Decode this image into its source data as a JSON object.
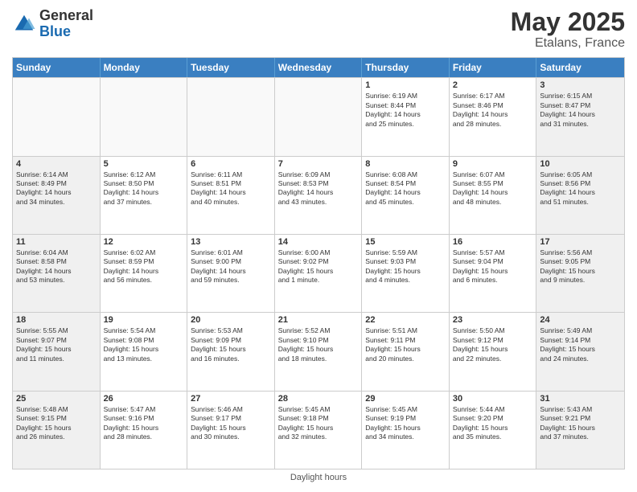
{
  "header": {
    "logo_general": "General",
    "logo_blue": "Blue",
    "title": "May 2025",
    "subtitle": "Etalans, France"
  },
  "calendar": {
    "days_of_week": [
      "Sunday",
      "Monday",
      "Tuesday",
      "Wednesday",
      "Thursday",
      "Friday",
      "Saturday"
    ],
    "footer": "Daylight hours",
    "rows": [
      [
        {
          "day": "",
          "text": "",
          "empty": true
        },
        {
          "day": "",
          "text": "",
          "empty": true
        },
        {
          "day": "",
          "text": "",
          "empty": true
        },
        {
          "day": "",
          "text": "",
          "empty": true
        },
        {
          "day": "1",
          "text": "Sunrise: 6:19 AM\nSunset: 8:44 PM\nDaylight: 14 hours\nand 25 minutes.",
          "empty": false
        },
        {
          "day": "2",
          "text": "Sunrise: 6:17 AM\nSunset: 8:46 PM\nDaylight: 14 hours\nand 28 minutes.",
          "empty": false
        },
        {
          "day": "3",
          "text": "Sunrise: 6:15 AM\nSunset: 8:47 PM\nDaylight: 14 hours\nand 31 minutes.",
          "empty": false,
          "shaded": true
        }
      ],
      [
        {
          "day": "4",
          "text": "Sunrise: 6:14 AM\nSunset: 8:49 PM\nDaylight: 14 hours\nand 34 minutes.",
          "empty": false,
          "shaded": true
        },
        {
          "day": "5",
          "text": "Sunrise: 6:12 AM\nSunset: 8:50 PM\nDaylight: 14 hours\nand 37 minutes.",
          "empty": false
        },
        {
          "day": "6",
          "text": "Sunrise: 6:11 AM\nSunset: 8:51 PM\nDaylight: 14 hours\nand 40 minutes.",
          "empty": false
        },
        {
          "day": "7",
          "text": "Sunrise: 6:09 AM\nSunset: 8:53 PM\nDaylight: 14 hours\nand 43 minutes.",
          "empty": false
        },
        {
          "day": "8",
          "text": "Sunrise: 6:08 AM\nSunset: 8:54 PM\nDaylight: 14 hours\nand 45 minutes.",
          "empty": false
        },
        {
          "day": "9",
          "text": "Sunrise: 6:07 AM\nSunset: 8:55 PM\nDaylight: 14 hours\nand 48 minutes.",
          "empty": false
        },
        {
          "day": "10",
          "text": "Sunrise: 6:05 AM\nSunset: 8:56 PM\nDaylight: 14 hours\nand 51 minutes.",
          "empty": false,
          "shaded": true
        }
      ],
      [
        {
          "day": "11",
          "text": "Sunrise: 6:04 AM\nSunset: 8:58 PM\nDaylight: 14 hours\nand 53 minutes.",
          "empty": false,
          "shaded": true
        },
        {
          "day": "12",
          "text": "Sunrise: 6:02 AM\nSunset: 8:59 PM\nDaylight: 14 hours\nand 56 minutes.",
          "empty": false
        },
        {
          "day": "13",
          "text": "Sunrise: 6:01 AM\nSunset: 9:00 PM\nDaylight: 14 hours\nand 59 minutes.",
          "empty": false
        },
        {
          "day": "14",
          "text": "Sunrise: 6:00 AM\nSunset: 9:02 PM\nDaylight: 15 hours\nand 1 minute.",
          "empty": false
        },
        {
          "day": "15",
          "text": "Sunrise: 5:59 AM\nSunset: 9:03 PM\nDaylight: 15 hours\nand 4 minutes.",
          "empty": false
        },
        {
          "day": "16",
          "text": "Sunrise: 5:57 AM\nSunset: 9:04 PM\nDaylight: 15 hours\nand 6 minutes.",
          "empty": false
        },
        {
          "day": "17",
          "text": "Sunrise: 5:56 AM\nSunset: 9:05 PM\nDaylight: 15 hours\nand 9 minutes.",
          "empty": false,
          "shaded": true
        }
      ],
      [
        {
          "day": "18",
          "text": "Sunrise: 5:55 AM\nSunset: 9:07 PM\nDaylight: 15 hours\nand 11 minutes.",
          "empty": false,
          "shaded": true
        },
        {
          "day": "19",
          "text": "Sunrise: 5:54 AM\nSunset: 9:08 PM\nDaylight: 15 hours\nand 13 minutes.",
          "empty": false
        },
        {
          "day": "20",
          "text": "Sunrise: 5:53 AM\nSunset: 9:09 PM\nDaylight: 15 hours\nand 16 minutes.",
          "empty": false
        },
        {
          "day": "21",
          "text": "Sunrise: 5:52 AM\nSunset: 9:10 PM\nDaylight: 15 hours\nand 18 minutes.",
          "empty": false
        },
        {
          "day": "22",
          "text": "Sunrise: 5:51 AM\nSunset: 9:11 PM\nDaylight: 15 hours\nand 20 minutes.",
          "empty": false
        },
        {
          "day": "23",
          "text": "Sunrise: 5:50 AM\nSunset: 9:12 PM\nDaylight: 15 hours\nand 22 minutes.",
          "empty": false
        },
        {
          "day": "24",
          "text": "Sunrise: 5:49 AM\nSunset: 9:14 PM\nDaylight: 15 hours\nand 24 minutes.",
          "empty": false,
          "shaded": true
        }
      ],
      [
        {
          "day": "25",
          "text": "Sunrise: 5:48 AM\nSunset: 9:15 PM\nDaylight: 15 hours\nand 26 minutes.",
          "empty": false,
          "shaded": true
        },
        {
          "day": "26",
          "text": "Sunrise: 5:47 AM\nSunset: 9:16 PM\nDaylight: 15 hours\nand 28 minutes.",
          "empty": false
        },
        {
          "day": "27",
          "text": "Sunrise: 5:46 AM\nSunset: 9:17 PM\nDaylight: 15 hours\nand 30 minutes.",
          "empty": false
        },
        {
          "day": "28",
          "text": "Sunrise: 5:45 AM\nSunset: 9:18 PM\nDaylight: 15 hours\nand 32 minutes.",
          "empty": false
        },
        {
          "day": "29",
          "text": "Sunrise: 5:45 AM\nSunset: 9:19 PM\nDaylight: 15 hours\nand 34 minutes.",
          "empty": false
        },
        {
          "day": "30",
          "text": "Sunrise: 5:44 AM\nSunset: 9:20 PM\nDaylight: 15 hours\nand 35 minutes.",
          "empty": false
        },
        {
          "day": "31",
          "text": "Sunrise: 5:43 AM\nSunset: 9:21 PM\nDaylight: 15 hours\nand 37 minutes.",
          "empty": false,
          "shaded": true
        }
      ]
    ]
  }
}
